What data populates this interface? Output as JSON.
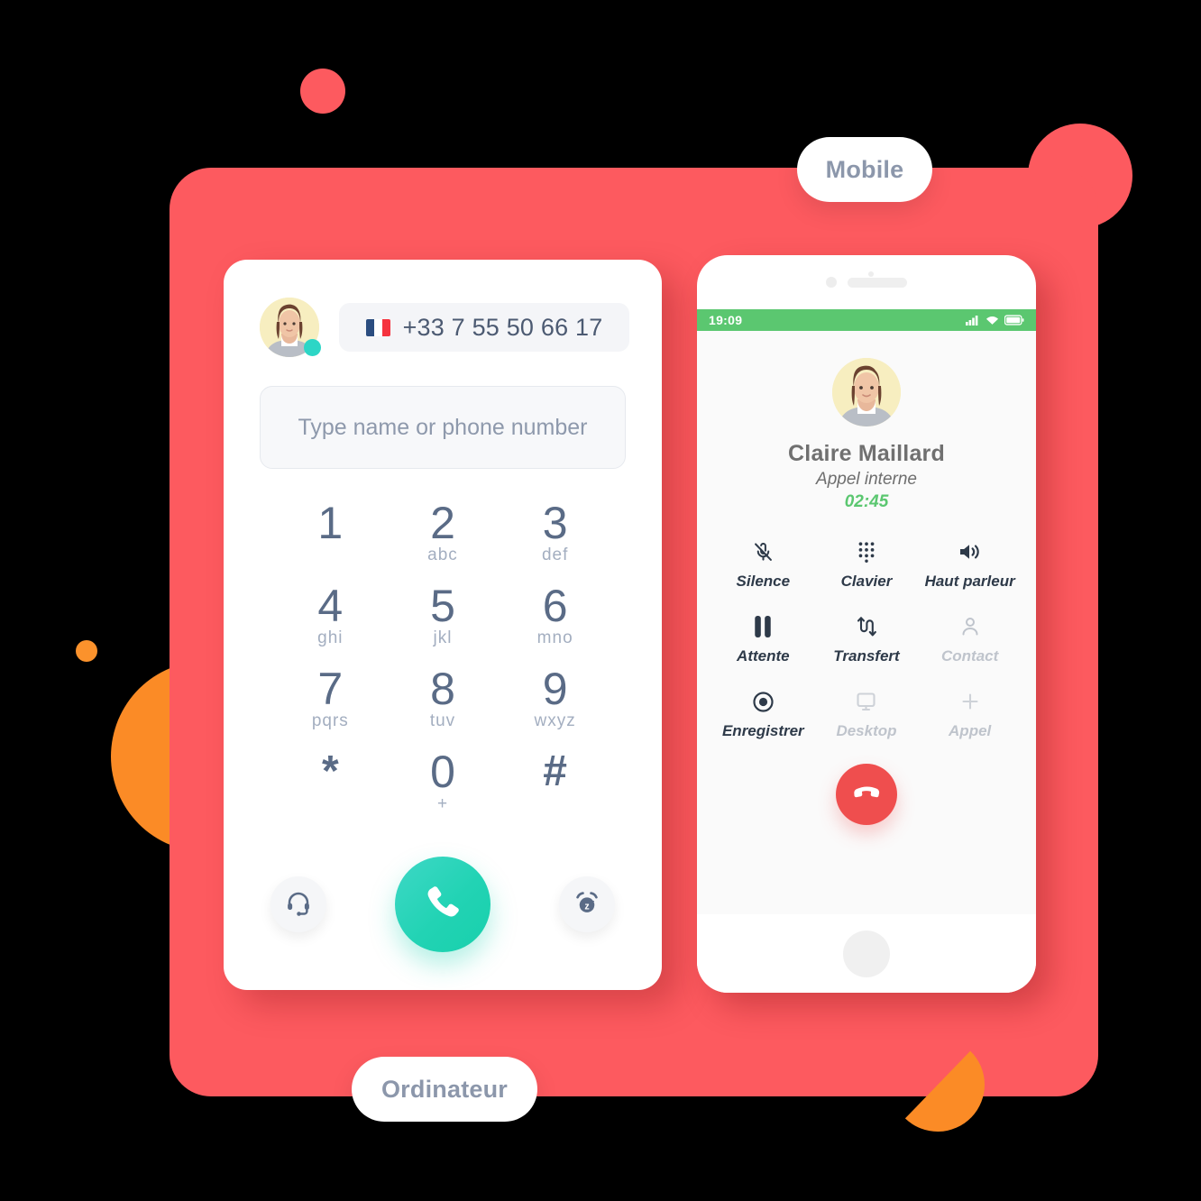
{
  "labels": {
    "mobile": "Mobile",
    "ordinateur": "Ordinateur"
  },
  "colors": {
    "panel_red": "#FD5A5F",
    "orange": "#FB8B26",
    "call_green": "#22D3B4",
    "hangup_red": "#EF4E4E",
    "status_green": "#5BC770",
    "online_dot": "#2DD6C6",
    "text_slate": "#4C5A72"
  },
  "dialer": {
    "avatar_name": "avatar",
    "status": "online",
    "country_flag": "flag-fr",
    "phone_number": "+33 7 55 50 66 17",
    "search_placeholder": "Type name or phone number",
    "search_value": "",
    "keys": [
      {
        "digit": "1",
        "letters": ""
      },
      {
        "digit": "2",
        "letters": "abc"
      },
      {
        "digit": "3",
        "letters": "def"
      },
      {
        "digit": "4",
        "letters": "ghi"
      },
      {
        "digit": "5",
        "letters": "jkl"
      },
      {
        "digit": "6",
        "letters": "mno"
      },
      {
        "digit": "7",
        "letters": "pqrs"
      },
      {
        "digit": "8",
        "letters": "tuv"
      },
      {
        "digit": "9",
        "letters": "wxyz"
      },
      {
        "digit": "*",
        "letters": ""
      },
      {
        "digit": "0",
        "letters": "+"
      },
      {
        "digit": "#",
        "letters": ""
      }
    ],
    "actions": {
      "headset": "headset-icon",
      "call": "call-icon",
      "snooze": "snooze-icon"
    }
  },
  "phone": {
    "statusbar": {
      "time": "19:09",
      "signal": "signal-icon",
      "wifi": "wifi-icon",
      "battery": "battery-icon"
    },
    "caller": {
      "name": "Claire Maillard",
      "type": "Appel interne",
      "timer": "02:45"
    },
    "controls": [
      {
        "label": "Silence",
        "icon": "mic-off-icon",
        "disabled": false
      },
      {
        "label": "Clavier",
        "icon": "keypad-icon",
        "disabled": false
      },
      {
        "label": "Haut parleur",
        "icon": "speaker-icon",
        "disabled": false
      },
      {
        "label": "Attente",
        "icon": "pause-icon",
        "disabled": false
      },
      {
        "label": "Transfert",
        "icon": "transfer-icon",
        "disabled": false
      },
      {
        "label": "Contact",
        "icon": "person-icon",
        "disabled": true
      },
      {
        "label": "Enregistrer",
        "icon": "record-icon",
        "disabled": false
      },
      {
        "label": "Desktop",
        "icon": "monitor-icon",
        "disabled": true
      },
      {
        "label": "Appel",
        "icon": "plus-icon",
        "disabled": true
      }
    ],
    "hangup": "hangup-icon",
    "home": "home-button"
  }
}
